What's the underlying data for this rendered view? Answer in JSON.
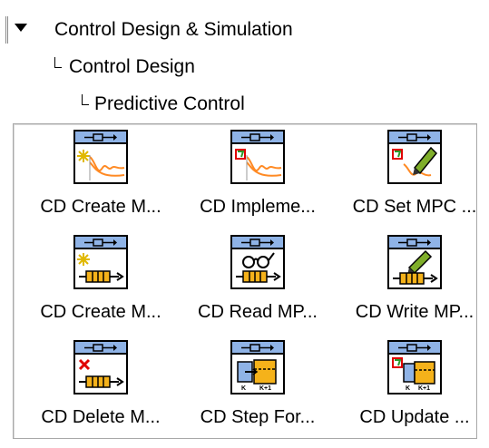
{
  "breadcrumb": {
    "items": [
      {
        "label": "Control Design & Simulation"
      },
      {
        "label": "Control Design"
      },
      {
        "label": "Predictive Control"
      }
    ]
  },
  "palette": {
    "items": [
      {
        "label": "CD Create M...",
        "icon": "create-model-icon"
      },
      {
        "label": "CD Impleme...",
        "icon": "implement-model-icon"
      },
      {
        "label": "CD Set MPC ...",
        "icon": "set-mpc-icon"
      },
      {
        "label": "CD Create M...",
        "icon": "create-queue-icon"
      },
      {
        "label": "CD Read MP...",
        "icon": "read-mpc-icon"
      },
      {
        "label": "CD Write MP...",
        "icon": "write-mpc-icon"
      },
      {
        "label": "CD Delete M...",
        "icon": "delete-model-icon"
      },
      {
        "label": "CD Step For...",
        "icon": "step-forward-icon"
      },
      {
        "label": "CD Update ...",
        "icon": "update-icon"
      }
    ]
  },
  "colors": {
    "connector": "#8fb3e6",
    "response_curve": "#ff8a24",
    "step_block": "#f5b21a",
    "delete_mark": "#e00000",
    "new_star": "#f2d500"
  }
}
